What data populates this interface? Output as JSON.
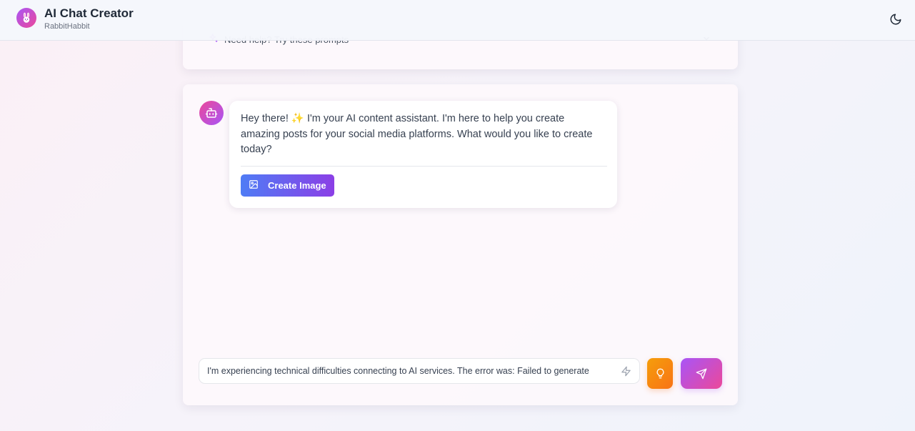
{
  "header": {
    "title": "AI Chat Creator",
    "subtitle": "RabbitHabbit",
    "avatar_icon": "rabbit-icon",
    "theme_toggle_icon": "moon-icon"
  },
  "help_panel": {
    "label": "Need help? Try these prompts",
    "icon": "sparkles-icon",
    "expand_icon": "chevron-down-icon"
  },
  "chat": {
    "messages": [
      {
        "role": "assistant",
        "avatar_icon": "bot-icon",
        "text": "Hey there! ✨ I'm your AI content assistant. I'm here to help you create amazing posts for your social media platforms. What would you like to create today?",
        "action": {
          "label": "Create Image",
          "icon": "image-icon"
        }
      }
    ]
  },
  "composer": {
    "value": "I'm experiencing technical difficulties connecting to AI services. The error was: Failed to generate",
    "placeholder": "",
    "enhance_icon": "bolt-icon",
    "ideas_button_icon": "lightbulb-icon",
    "send_button_icon": "send-icon"
  },
  "colors": {
    "brand_gradient_start": "#a855f7",
    "brand_gradient_end": "#ec4899",
    "create_button_start": "#4f7cf5",
    "create_button_end": "#8b3fe6",
    "ideas_button": "#f59e0b"
  }
}
